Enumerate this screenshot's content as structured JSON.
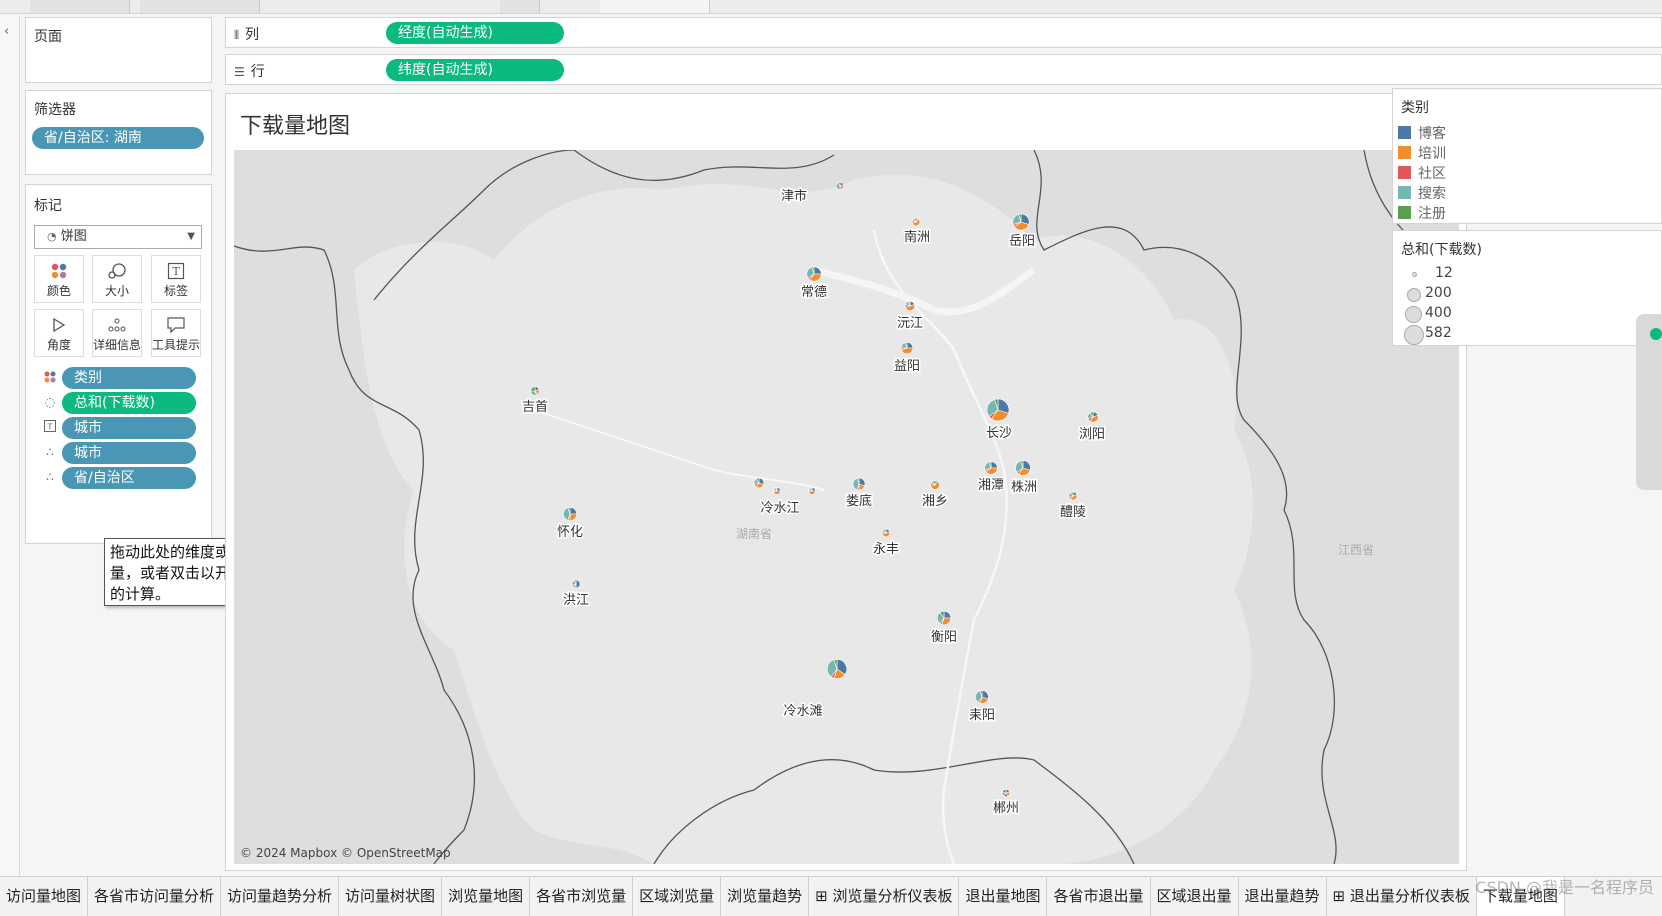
{
  "shelves": {
    "columns": {
      "label": "列",
      "pill": "经度(自动生成)"
    },
    "rows": {
      "label": "行",
      "pill": "纬度(自动生成)"
    }
  },
  "pages_card": {
    "title": "页面"
  },
  "filters_card": {
    "title": "筛选器",
    "filter": "省/自治区: 湖南"
  },
  "marks_card": {
    "title": "标记",
    "mark_type": "饼图",
    "buttons": [
      "颜色",
      "大小",
      "标签",
      "角度",
      "详细信息",
      "工具提示"
    ],
    "fields": [
      "类别",
      "总和(下载数)",
      "城市",
      "城市",
      "省/自治区"
    ]
  },
  "tooltip": "拖动此处的维度或度量，或者双击以开始新的计算。",
  "viz": {
    "title": "下载量地图",
    "attribution": "© 2024 Mapbox © OpenStreetMap",
    "province_labels": [
      "湖南省",
      "江西省"
    ],
    "colors": {
      "博客": "#4e79a7",
      "培训": "#f28e2b",
      "社区": "#e15759",
      "搜索": "#76b7b2",
      "注册": "#59a14f"
    },
    "cities": [
      {
        "name": "津市",
        "size": 12,
        "shares": [
          0.2,
          0.2,
          0.1,
          0.4,
          0.1
        ]
      },
      {
        "name": "南洲",
        "size": 16,
        "shares": [
          0.1,
          0.6,
          0.1,
          0.1,
          0.1
        ]
      },
      {
        "name": "岳阳",
        "size": 260,
        "shares": [
          0.3,
          0.35,
          0.05,
          0.25,
          0.05
        ]
      },
      {
        "name": "常德",
        "size": 180,
        "shares": [
          0.25,
          0.35,
          0.05,
          0.3,
          0.05
        ]
      },
      {
        "name": "沅江",
        "size": 40,
        "shares": [
          0.2,
          0.5,
          0.1,
          0.15,
          0.05
        ]
      },
      {
        "name": "益阳",
        "size": 90,
        "shares": [
          0.25,
          0.45,
          0.05,
          0.2,
          0.05
        ]
      },
      {
        "name": "吉首",
        "size": 25,
        "shares": [
          0.2,
          0.2,
          0.05,
          0.3,
          0.25
        ]
      },
      {
        "name": "长沙",
        "size": 582,
        "shares": [
          0.3,
          0.3,
          0.05,
          0.3,
          0.05
        ]
      },
      {
        "name": "浏阳",
        "size": 60,
        "shares": [
          0.2,
          0.4,
          0.1,
          0.2,
          0.1
        ]
      },
      {
        "name": "湘潭",
        "size": 120,
        "shares": [
          0.25,
          0.4,
          0.05,
          0.25,
          0.05
        ]
      },
      {
        "name": "株洲",
        "size": 200,
        "shares": [
          0.3,
          0.3,
          0.05,
          0.3,
          0.05
        ]
      },
      {
        "name": "湘乡",
        "size": 30,
        "shares": [
          0.1,
          0.6,
          0.1,
          0.1,
          0.1
        ]
      },
      {
        "name": "娄底",
        "size": 100,
        "shares": [
          0.3,
          0.2,
          0.05,
          0.4,
          0.05
        ]
      },
      {
        "name": "冷水江",
        "size": 45,
        "shares": [
          0.3,
          0.3,
          0.1,
          0.2,
          0.1
        ]
      },
      {
        "name": "醴陵",
        "size": 20,
        "shares": [
          0.2,
          0.4,
          0.1,
          0.2,
          0.1
        ]
      },
      {
        "name": "怀化",
        "size": 140,
        "shares": [
          0.25,
          0.25,
          0.05,
          0.4,
          0.05
        ]
      },
      {
        "name": "永丰",
        "size": 15,
        "shares": [
          0.2,
          0.5,
          0.1,
          0.1,
          0.1
        ]
      },
      {
        "name": "洪江",
        "size": 18,
        "shares": [
          0.5,
          0.1,
          0.1,
          0.2,
          0.1
        ]
      },
      {
        "name": "衡阳",
        "size": 150,
        "shares": [
          0.25,
          0.3,
          0.05,
          0.3,
          0.1
        ]
      },
      {
        "name": "冷水滩",
        "size": 420,
        "shares": [
          0.35,
          0.2,
          0.05,
          0.35,
          0.05
        ]
      },
      {
        "name": "耒阳",
        "size": 130,
        "shares": [
          0.3,
          0.25,
          0.05,
          0.35,
          0.05
        ]
      },
      {
        "name": "郴州",
        "size": 12,
        "shares": [
          0.2,
          0.2,
          0.2,
          0.2,
          0.2
        ]
      }
    ]
  },
  "category_legend": {
    "title": "类别",
    "items": [
      {
        "label": "博客",
        "color": "#4e79a7"
      },
      {
        "label": "培训",
        "color": "#f28e2b"
      },
      {
        "label": "社区",
        "color": "#e15759"
      },
      {
        "label": "搜索",
        "color": "#76b7b2"
      },
      {
        "label": "注册",
        "color": "#59a14f"
      }
    ]
  },
  "size_legend": {
    "title": "总和(下载数)",
    "items": [
      "12",
      "200",
      "400",
      "582"
    ]
  },
  "bottom_tabs": [
    "访问量地图",
    "各省市访问量分析",
    "访问量趋势分析",
    "访问量树状图",
    "浏览量地图",
    "各省市浏览量",
    "区域浏览量",
    "浏览量趋势",
    "浏览量分析仪表板",
    "退出量地图",
    "各省市退出量",
    "区域退出量",
    "退出量趋势",
    "退出量分析仪表板",
    "下载量地图"
  ],
  "watermark": "CSDN @我是一名程序员"
}
